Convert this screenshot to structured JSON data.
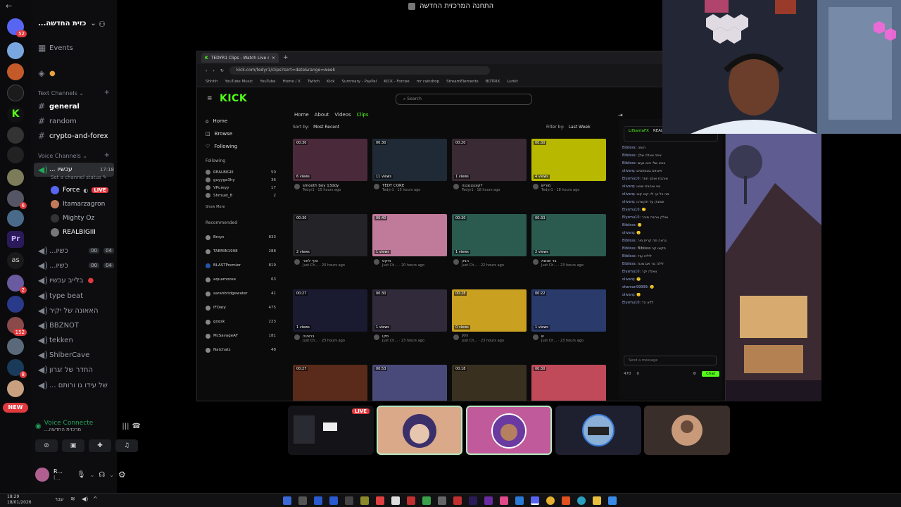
{
  "window": {
    "stage_title": "התחנה המרכזית החדשה"
  },
  "servers": {
    "badges": [
      "52",
      "2",
      "6",
      "2",
      "152",
      "6",
      "8"
    ],
    "new_label": "NEW",
    "as_label": "as"
  },
  "sidebar": {
    "server_name": "...כזית החדשה",
    "events_label": "Events",
    "text_category": "Text Channels",
    "text_channels": [
      "general",
      "random",
      "crypto-and-forex"
    ],
    "voice_category": "Voice Channels",
    "active_voice": {
      "name": "... עכשיו",
      "timer": "17:18",
      "status_placeholder": "Set a channel status",
      "users": [
        {
          "name": "Force",
          "live": "LIVE"
        },
        {
          "name": "Itamarzagron"
        },
        {
          "name": "Mighty Oz"
        },
        {
          "name": "REALBIGIII"
        }
      ]
    },
    "voice_channels": [
      {
        "name": "...כשיו",
        "count_a": "00",
        "count_b": "04"
      },
      {
        "name": "...כשיו",
        "count_a": "00",
        "count_b": "04"
      },
      {
        "name": "בלייב עכשיו"
      },
      {
        "name": "type beat"
      },
      {
        "name": "האאונה של יקיר"
      },
      {
        "name": "BBZNOT"
      },
      {
        "name": "tekken"
      },
      {
        "name": "ShiberCave"
      },
      {
        "name": "החדר של זגרון"
      },
      {
        "name": "... של עידו גו ורותם"
      }
    ],
    "voice_panel": {
      "status": "Voice Connecte",
      "channel": "...מרכזית החדשה"
    },
    "user_panel": {
      "name": "R...",
      "sub": "I..."
    }
  },
  "browser": {
    "tab_title": "TEDYR1 Clips - Watch Live on Ki",
    "url": "kick.com/tedyr1/clips?sort=date&range=week",
    "bookmarks": [
      "Shhhh",
      "YouTube Music",
      "YouTube",
      "Home / X",
      "Twitch",
      "Kick",
      "Summary - PayPal",
      "KICK - Forcee",
      "mr raindrop",
      "StreamElements",
      "BOTRIX",
      "Lurkit"
    ]
  },
  "kick": {
    "logo": "KICK",
    "search_placeholder": "Search",
    "nav": [
      "Home",
      "Browse",
      "Following"
    ],
    "following_label": "Following",
    "following_users": [
      {
        "name": "REALBIGIII",
        "count": "50"
      },
      {
        "name": "guyyga3hy",
        "count": "36"
      },
      {
        "name": "VPureyy",
        "count": "17"
      },
      {
        "name": "Shmuel_8",
        "count": "2"
      }
    ],
    "show_more": "Show More",
    "recommended_label": "Recommended",
    "recommended_users": [
      {
        "name": "Broys",
        "count": "833"
      },
      {
        "name": "TAEMIN1998",
        "count": "288"
      },
      {
        "name": "BLASTPremier",
        "count": "819"
      },
      {
        "name": "aquamoose",
        "count": "63"
      },
      {
        "name": "sarahbridgewater",
        "count": "41"
      },
      {
        "name": "IFOaty",
        "count": "475"
      },
      {
        "name": "goqsk",
        "count": "223"
      },
      {
        "name": "McSavageAF",
        "count": "181"
      },
      {
        "name": "Natchatz",
        "count": "48"
      }
    ],
    "tabs": [
      "Home",
      "About",
      "Videos",
      "Clips"
    ],
    "sort_label": "Sort by:",
    "sort_value": "Most Recent",
    "filter_label": "Filter by:",
    "filter_value": "Last Week",
    "clips": [
      {
        "dur": "00:30",
        "views": "6 views",
        "title": "smooth boy 13ddy",
        "sub": "Tedyr1 · 15 hours ago",
        "color": "#4a2a3a"
      },
      {
        "dur": "00:30",
        "views": "11 views",
        "title": "TEDY CORE",
        "sub": "Tedyr1 · 15 hours ago",
        "color": "#1f2a36"
      },
      {
        "dur": "00:20",
        "views": "1 views",
        "title": "קוננננננננה?",
        "sub": "Tedyr1 · 18 hours ago",
        "color": "#3a2a33"
      },
      {
        "dur": "00:30",
        "views": "4 views",
        "title": "מוריש",
        "sub": "Tedyr1 · 18 hours ago",
        "color": "#b8b800"
      },
      {
        "dur": "00:30",
        "views": "2 views",
        "title": "סוף לאור",
        "sub": "Just Ch... · 20 hours ago",
        "color": "#232328"
      },
      {
        "dur": "00:40",
        "views": "1 views",
        "title": "מיקס",
        "sub": "Just Ch... · 20 hours ago",
        "color": "#c07a9a"
      },
      {
        "dur": "00:30",
        "views": "1 views",
        "title": "הגיון",
        "sub": "Just Ch... · 22 hours ago",
        "color": "#2b5a4f"
      },
      {
        "dur": "00:33",
        "views": "2 views",
        "title": "בד שנשא",
        "sub": "Just Ch... · 23 hours ago",
        "color": "#2b5a4f"
      },
      {
        "dur": "00:27",
        "views": "1 views",
        "title": "ברצינה",
        "sub": "Just Ch... · 23 hours ago",
        "color": "#1a1a30"
      },
      {
        "dur": "00:30",
        "views": "1 views",
        "title": "מקו",
        "sub": "Just Ch... · 23 hours ago",
        "color": "#302a3a"
      },
      {
        "dur": "00:28",
        "views": "0 views",
        "title": "???",
        "sub": "Just Ch... · 23 hours ago",
        "color": "#c9a020"
      },
      {
        "dur": "00:22",
        "views": "1 views",
        "title": "ש",
        "sub": "Just Ch... · 23 hours ago",
        "color": "#2a3a6a"
      },
      {
        "dur": "00:27",
        "views": "",
        "title": "",
        "sub": "",
        "color": "#5a2a1a"
      },
      {
        "dur": "00:53",
        "views": "",
        "title": "",
        "sub": "",
        "color": "#4a4a7a"
      },
      {
        "dur": "00:18",
        "views": "",
        "title": "",
        "sub": "",
        "color": "#3a3020"
      },
      {
        "dur": "00:30",
        "views": "",
        "title": "",
        "sub": "",
        "color": "#c04a5a"
      }
    ],
    "chat_header": "LilSantaFX",
    "chat_pinned": "REALBIGIII",
    "chat_lines": [
      {
        "n": "Bibiisss",
        "t": "הופה"
      },
      {
        "n": "Bibiisss",
        "t": "איזה וואלה שלך"
      },
      {
        "n": "Bibiisss",
        "t": "באא שלי הוא נעים"
      },
      {
        "n": "olivarq",
        "t": "איגוזים בטמפונים"
      },
      {
        "n": "Elysmu10",
        "t": "אוהבת אותך חוזר"
      },
      {
        "n": "olivarq",
        "t": "אני אוהבת שגאו"
      },
      {
        "n": "olivarq",
        "t": "מה כל כך ליו קבו קוב"
      },
      {
        "n": "olivarq",
        "t": "שמבק עד תקשרגו"
      },
      {
        "n": "Elysmu10",
        "t": "🙂"
      },
      {
        "n": "Elysmu10",
        "t": "ואלק אהבה מוכר"
      },
      {
        "n": "Bibiisss",
        "t": "🙂"
      },
      {
        "n": "olivarq",
        "t": "🙂"
      },
      {
        "n": "Bibiisss",
        "t": "נראה תה קרית מיר"
      },
      {
        "n": "Bibiisss",
        "t": "Bibiisss תקשו קב"
      },
      {
        "n": "Bibiisss",
        "t": "ליליה עוד"
      },
      {
        "n": "Bibiisss",
        "t": "לילה נור אם מכח"
      },
      {
        "n": "Elysmu10",
        "t": "וואלה יקר"
      },
      {
        "n": "olivarq",
        "t": "🙂"
      },
      {
        "n": "shaman99999",
        "t": "🙂"
      },
      {
        "n": "olivarq",
        "t": "🙂"
      },
      {
        "n": "Elysmu10",
        "t": "ללא הד"
      }
    ],
    "chat_input_placeholder": "Send a message",
    "chat_button": "Chat",
    "chat_count": "470",
    "chat_count2": "0"
  },
  "participants": {
    "live_label": "LIVE"
  },
  "taskbar": {
    "time": "18:29",
    "date": "18/01/2026",
    "lang": "עבר"
  },
  "colors": {
    "kick_green": "#53fc18",
    "discord_red": "#e03a3e",
    "sidebar_bg": "#0d0d10"
  }
}
